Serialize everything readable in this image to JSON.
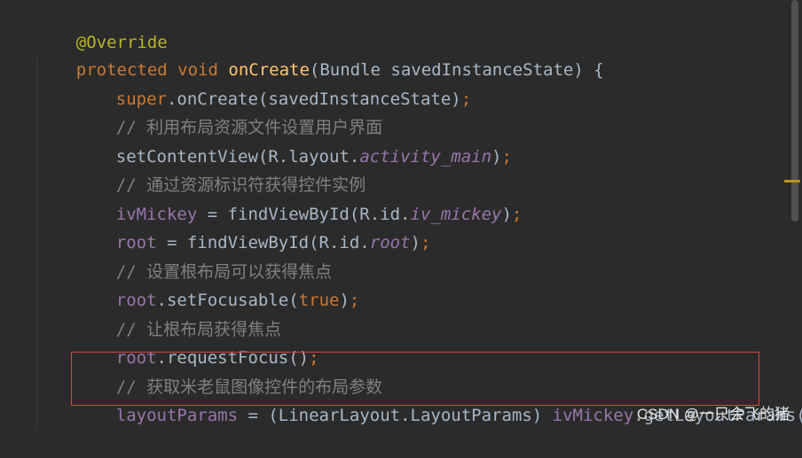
{
  "code": {
    "l1": {
      "annotation": "@Override"
    },
    "l2": {
      "kw_protected": "protected",
      "sp1": " ",
      "kw_void": "void",
      "sp2": " ",
      "method": "onCreate",
      "params": "(Bundle savedInstanceState) {"
    },
    "l3": {
      "kw_super": "super",
      "call": ".onCreate(savedInstanceState)",
      "semi": ";"
    },
    "l4": {
      "comment": "// 利用布局资源文件设置用户界面"
    },
    "l5": {
      "call": "setContentView(R.layout.",
      "field": "activity_main",
      "close": ")",
      "semi": ";"
    },
    "l6": {
      "comment": "// 通过资源标识符获得控件实例"
    },
    "l7": {
      "var": "ivMickey",
      "assign": " = findViewById(R.id.",
      "field": "iv_mickey",
      "close": ")",
      "semi": ";"
    },
    "l8": {
      "var": "root",
      "assign": " = findViewById(R.id.",
      "field": "root",
      "close": ")",
      "semi": ";"
    },
    "l9": {
      "comment": "// 设置根布局可以获得焦点"
    },
    "l10": {
      "var": "root",
      "call": ".setFocusable(",
      "kw_true": "true",
      "close": ")",
      "semi": ";"
    },
    "l11": {
      "comment": "// 让根布局获得焦点"
    },
    "l12": {
      "var": "root",
      "call": ".requestFocus()",
      "semi": ";"
    },
    "l13": {
      "comment": "// 获取米老鼠图像控件的布局参数"
    },
    "l14": {
      "var": "layoutParams",
      "cast": " = (LinearLayout.LayoutParams) ",
      "var2": "ivMickey",
      "call": ".getLayoutParams()",
      "semi": ";"
    }
  },
  "watermark": "CSDN @一只会飞的猪",
  "colors": {
    "background": "#2b2b2b",
    "keyword": "#cc7832",
    "annotation": "#bbb529",
    "method": "#ffc66d",
    "field": "#9876aa",
    "comment": "#808080",
    "plain": "#a9b7c6",
    "highlight_box": "#e0413c"
  }
}
